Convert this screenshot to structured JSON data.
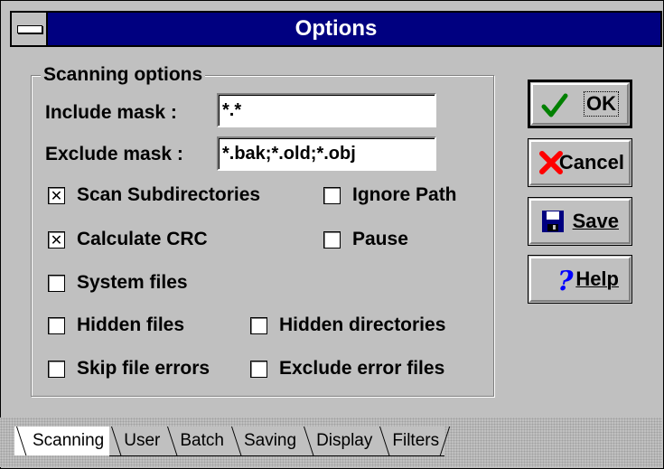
{
  "window": {
    "title": "Options"
  },
  "group": {
    "label": "Scanning options"
  },
  "include": {
    "label": "Include mask :",
    "value": "*.*"
  },
  "exclude": {
    "label": "Exclude mask :",
    "value": "*.bak;*.old;*.obj"
  },
  "checkboxes": [
    {
      "label": "Scan Subdirectories",
      "checked": true
    },
    {
      "label": "Ignore Path",
      "checked": false
    },
    {
      "label": "Calculate CRC",
      "checked": true
    },
    {
      "label": "Pause",
      "checked": false
    },
    {
      "label": "System files",
      "checked": false
    },
    {
      "label": "Hidden files",
      "checked": false
    },
    {
      "label": "Hidden directories",
      "checked": false
    },
    {
      "label": "Skip file errors",
      "checked": false
    },
    {
      "label": "Exclude error files",
      "checked": false
    }
  ],
  "buttons": {
    "ok": {
      "label": "OK",
      "icon": "checkmark-icon"
    },
    "cancel": {
      "label": "Cancel",
      "icon": "red-x-icon"
    },
    "save": {
      "label": "Save",
      "icon": "floppy-disk-icon"
    },
    "help": {
      "label": "Help",
      "icon": "question-mark-icon"
    }
  },
  "tabs": [
    "Scanning",
    "User",
    "Batch",
    "Saving",
    "Display",
    "Filters"
  ],
  "active_tab": "Scanning",
  "colors": {
    "titlebar": "#000080",
    "face": "#c0c0c0",
    "check_green": "#008000",
    "cancel_red": "#ff0000",
    "help_blue": "#0000ff"
  }
}
